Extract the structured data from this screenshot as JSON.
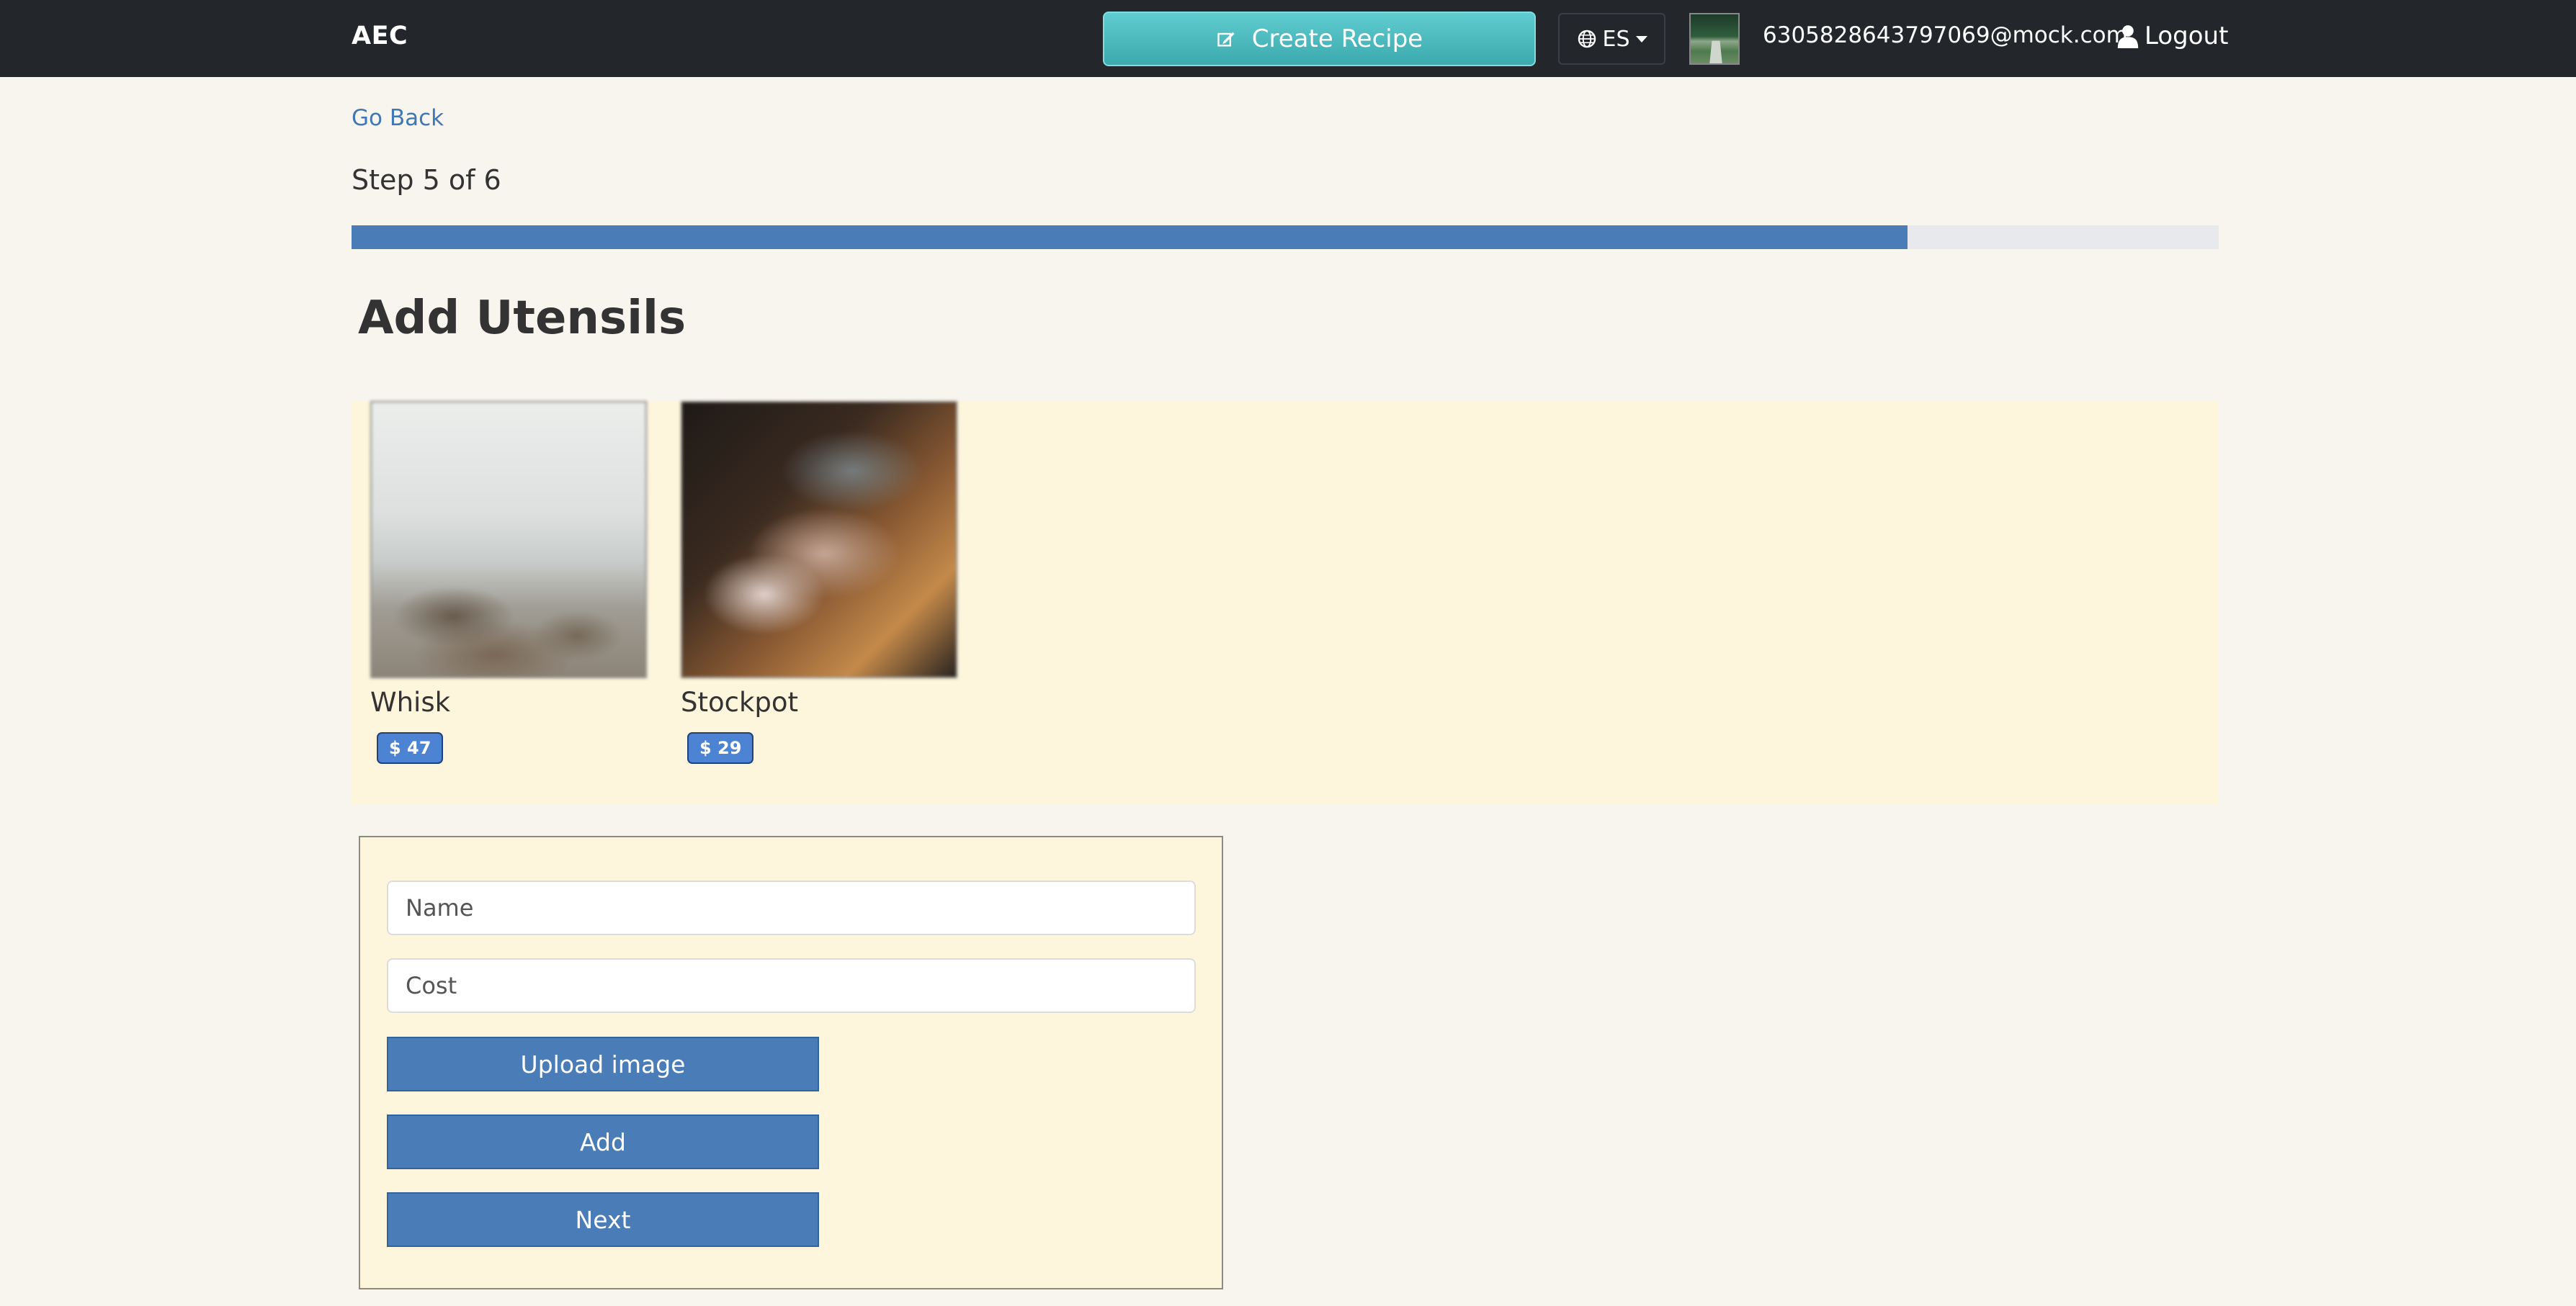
{
  "nav": {
    "brand": "AEC",
    "create_label": "Create Recipe",
    "lang_label": "ES",
    "email": "6305828643797069@mock.com",
    "logout_label": "Logout"
  },
  "page": {
    "go_back": "Go Back",
    "step_text": "Step 5 of 6",
    "progress_fraction": 0.8333,
    "heading": "Add Utensils"
  },
  "utensils": [
    {
      "name": "Whisk",
      "price": "$ 47"
    },
    {
      "name": "Stockpot",
      "price": "$ 29"
    }
  ],
  "form": {
    "name_placeholder": "Name",
    "cost_placeholder": "Cost",
    "upload_label": "Upload image",
    "add_label": "Add",
    "next_label": "Next"
  },
  "icons": {
    "create": "edit-icon",
    "language": "globe-icon",
    "logout": "user-icon"
  },
  "colors": {
    "navbar": "#23272b",
    "accent_teal": "#5fcdd0",
    "primary_blue": "#4a7db7",
    "badge_blue": "#4c83d2",
    "panel_bg": "#fdf5dc",
    "page_bg": "#f8f5ee"
  }
}
